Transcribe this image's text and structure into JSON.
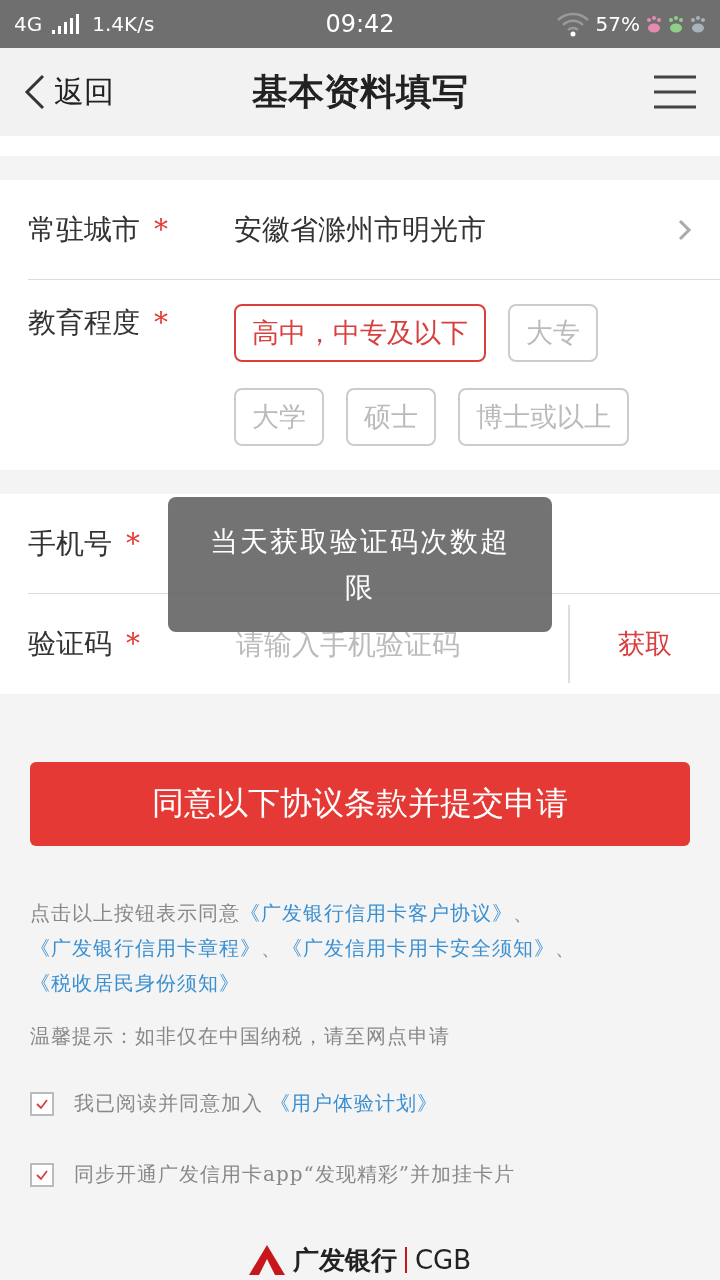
{
  "status_bar": {
    "network": "4G",
    "speed": "1.4K/s",
    "time": "09:42",
    "battery": "57%"
  },
  "header": {
    "back": "返回",
    "title": "基本资料填写"
  },
  "city": {
    "label": "常驻城市",
    "required": "*",
    "value": "安徽省滁州市明光市"
  },
  "education": {
    "label": "教育程度",
    "required": "*",
    "options": [
      {
        "label": "高中，中专及以下",
        "selected": true
      },
      {
        "label": "大专",
        "selected": false
      },
      {
        "label": "大学",
        "selected": false
      },
      {
        "label": "硕士",
        "selected": false
      },
      {
        "label": "博士或以上",
        "selected": false
      }
    ]
  },
  "phone": {
    "label": "手机号",
    "required": "*"
  },
  "code": {
    "label": "验证码",
    "required": "*",
    "placeholder": "请输入手机验证码",
    "button": "获取"
  },
  "toast": "当天获取验证码次数超限",
  "submit": "同意以下协议条款并提交申请",
  "agreement": [
    {
      "kind": "text",
      "text": "点击以上按钮表示同意"
    },
    {
      "kind": "link",
      "text": "《广发银行信用卡客户协议》"
    },
    {
      "kind": "text",
      "text": "、"
    },
    {
      "kind": "link",
      "text": "《广发银行信用卡章程》"
    },
    {
      "kind": "text",
      "text": "、"
    },
    {
      "kind": "link",
      "text": "《广发信用卡用卡安全须知》"
    },
    {
      "kind": "text",
      "text": "、"
    },
    {
      "kind": "link",
      "text": "《税收居民身份须知》"
    }
  ],
  "tip": "温馨提示：如非仅在中国纳税，请至网点申请",
  "checks": [
    {
      "checked": true,
      "text": "我已阅读并同意加入",
      "link": "《用户体验计划》"
    },
    {
      "checked": true,
      "text": "同步开通广发信用卡app“发现精彩”并加挂卡片"
    }
  ],
  "footer": {
    "brand": "广发银行",
    "code": "CGB"
  }
}
